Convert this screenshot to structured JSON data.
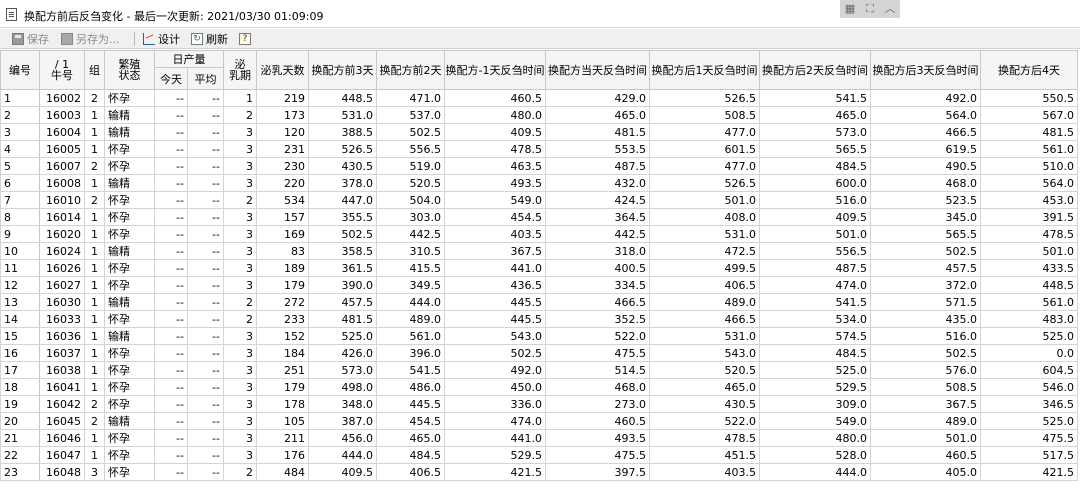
{
  "window": {
    "title": "换配方前后反刍变化 - 最后一次更新: 2021/03/30 01:09:09",
    "controls": [
      "▦",
      "⛶",
      "︿"
    ]
  },
  "toolbar": {
    "save_label": "保存",
    "saveas_label": "另存为...",
    "design_label": "设计",
    "refresh_label": "刷新",
    "help_label": "?"
  },
  "table": {
    "headers": {
      "index": "编号",
      "cow_top": "/ 1",
      "cow": "牛号",
      "group": "组",
      "breed1": "繁殖",
      "breed2": "状态",
      "daily": "日产量",
      "today": "今天",
      "avg": "平均",
      "lac1": "泌",
      "lac2": "乳期",
      "days": "泌乳天数",
      "before3": "换配方前3天",
      "before2": "换配方前2天",
      "before1": "换配方-1天反刍时间",
      "same": "换配方当天反刍时间",
      "after1": "换配方后1天反刍时间",
      "after2": "换配方后2天反刍时间",
      "after3": "换配方后3天反刍时间",
      "after4": "换配方后4天"
    },
    "rows": [
      [
        "1",
        "16002",
        "2",
        "怀孕",
        "--",
        "--",
        "1",
        "219",
        "448.5",
        "471.0",
        "460.5",
        "429.0",
        "526.5",
        "541.5",
        "492.0",
        "550.5"
      ],
      [
        "2",
        "16003",
        "1",
        "输精",
        "--",
        "--",
        "2",
        "173",
        "531.0",
        "537.0",
        "480.0",
        "465.0",
        "508.5",
        "465.0",
        "564.0",
        "567.0"
      ],
      [
        "3",
        "16004",
        "1",
        "输精",
        "--",
        "--",
        "3",
        "120",
        "388.5",
        "502.5",
        "409.5",
        "481.5",
        "477.0",
        "573.0",
        "466.5",
        "481.5"
      ],
      [
        "4",
        "16005",
        "1",
        "怀孕",
        "--",
        "--",
        "3",
        "231",
        "526.5",
        "556.5",
        "478.5",
        "553.5",
        "601.5",
        "565.5",
        "619.5",
        "561.0"
      ],
      [
        "5",
        "16007",
        "2",
        "怀孕",
        "--",
        "--",
        "3",
        "230",
        "430.5",
        "519.0",
        "463.5",
        "487.5",
        "477.0",
        "484.5",
        "490.5",
        "510.0"
      ],
      [
        "6",
        "16008",
        "1",
        "输精",
        "--",
        "--",
        "3",
        "220",
        "378.0",
        "520.5",
        "493.5",
        "432.0",
        "526.5",
        "600.0",
        "468.0",
        "564.0"
      ],
      [
        "7",
        "16010",
        "2",
        "怀孕",
        "--",
        "--",
        "2",
        "534",
        "447.0",
        "504.0",
        "549.0",
        "424.5",
        "501.0",
        "516.0",
        "523.5",
        "453.0"
      ],
      [
        "8",
        "16014",
        "1",
        "怀孕",
        "--",
        "--",
        "3",
        "157",
        "355.5",
        "303.0",
        "454.5",
        "364.5",
        "408.0",
        "409.5",
        "345.0",
        "391.5"
      ],
      [
        "9",
        "16020",
        "1",
        "怀孕",
        "--",
        "--",
        "3",
        "169",
        "502.5",
        "442.5",
        "403.5",
        "442.5",
        "531.0",
        "501.0",
        "565.5",
        "478.5"
      ],
      [
        "10",
        "16024",
        "1",
        "输精",
        "--",
        "--",
        "3",
        "83",
        "358.5",
        "310.5",
        "367.5",
        "318.0",
        "472.5",
        "556.5",
        "502.5",
        "501.0"
      ],
      [
        "11",
        "16026",
        "1",
        "怀孕",
        "--",
        "--",
        "3",
        "189",
        "361.5",
        "415.5",
        "441.0",
        "400.5",
        "499.5",
        "487.5",
        "457.5",
        "433.5"
      ],
      [
        "12",
        "16027",
        "1",
        "怀孕",
        "--",
        "--",
        "3",
        "179",
        "390.0",
        "349.5",
        "436.5",
        "334.5",
        "406.5",
        "474.0",
        "372.0",
        "448.5"
      ],
      [
        "13",
        "16030",
        "1",
        "输精",
        "--",
        "--",
        "2",
        "272",
        "457.5",
        "444.0",
        "445.5",
        "466.5",
        "489.0",
        "541.5",
        "571.5",
        "561.0"
      ],
      [
        "14",
        "16033",
        "1",
        "怀孕",
        "--",
        "--",
        "2",
        "233",
        "481.5",
        "489.0",
        "445.5",
        "352.5",
        "466.5",
        "534.0",
        "435.0",
        "483.0"
      ],
      [
        "15",
        "16036",
        "1",
        "输精",
        "--",
        "--",
        "3",
        "152",
        "525.0",
        "561.0",
        "543.0",
        "522.0",
        "531.0",
        "574.5",
        "516.0",
        "525.0"
      ],
      [
        "16",
        "16037",
        "1",
        "怀孕",
        "--",
        "--",
        "3",
        "184",
        "426.0",
        "396.0",
        "502.5",
        "475.5",
        "543.0",
        "484.5",
        "502.5",
        "0.0"
      ],
      [
        "17",
        "16038",
        "1",
        "怀孕",
        "--",
        "--",
        "3",
        "251",
        "573.0",
        "541.5",
        "492.0",
        "514.5",
        "520.5",
        "525.0",
        "576.0",
        "604.5"
      ],
      [
        "18",
        "16041",
        "1",
        "怀孕",
        "--",
        "--",
        "3",
        "179",
        "498.0",
        "486.0",
        "450.0",
        "468.0",
        "465.0",
        "529.5",
        "508.5",
        "546.0"
      ],
      [
        "19",
        "16042",
        "2",
        "怀孕",
        "--",
        "--",
        "3",
        "178",
        "348.0",
        "445.5",
        "336.0",
        "273.0",
        "430.5",
        "309.0",
        "367.5",
        "346.5"
      ],
      [
        "20",
        "16045",
        "2",
        "输精",
        "--",
        "--",
        "3",
        "105",
        "387.0",
        "454.5",
        "474.0",
        "460.5",
        "522.0",
        "549.0",
        "489.0",
        "525.0"
      ],
      [
        "21",
        "16046",
        "1",
        "怀孕",
        "--",
        "--",
        "3",
        "211",
        "456.0",
        "465.0",
        "441.0",
        "493.5",
        "478.5",
        "480.0",
        "501.0",
        "475.5"
      ],
      [
        "22",
        "16047",
        "1",
        "怀孕",
        "--",
        "--",
        "3",
        "176",
        "444.0",
        "484.5",
        "529.5",
        "475.5",
        "451.5",
        "528.0",
        "460.5",
        "517.5"
      ],
      [
        "23",
        "16048",
        "3",
        "怀孕",
        "--",
        "--",
        "2",
        "484",
        "409.5",
        "406.5",
        "421.5",
        "397.5",
        "403.5",
        "444.0",
        "405.0",
        "421.5"
      ]
    ]
  }
}
